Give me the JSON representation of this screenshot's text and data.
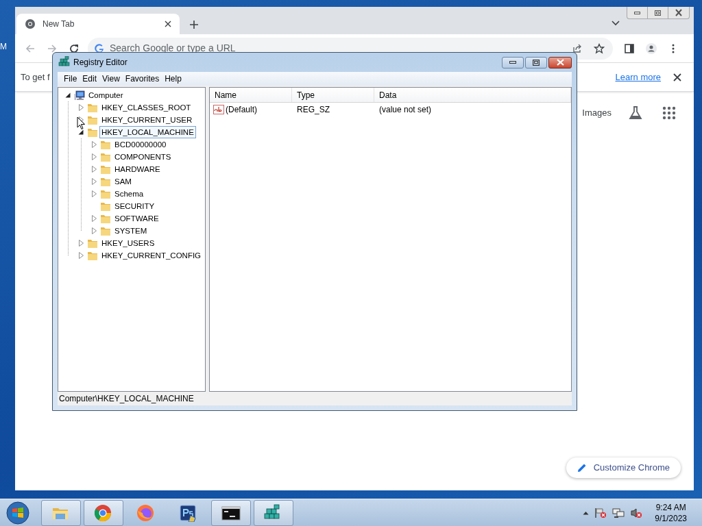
{
  "desktop": {
    "icon_label": "M"
  },
  "browser": {
    "tabs": [
      {
        "label": "New Tab",
        "selected": true
      }
    ],
    "omnibox": {
      "placeholder": "Search Google or type a URL"
    },
    "infobar": {
      "text": "To get f",
      "link": "Learn more"
    },
    "ntp_links": [
      "Images"
    ],
    "customize_button": "Customize Chrome"
  },
  "regedit": {
    "window": {
      "title": "Registry Editor"
    },
    "menu": [
      "File",
      "Edit",
      "View",
      "Favorites",
      "Help"
    ],
    "tree": [
      {
        "kind": "computer",
        "label": "Computer",
        "expandable": true,
        "expanded": true,
        "selected": false,
        "children": [
          {
            "kind": "folder",
            "label": "HKEY_CLASSES_ROOT",
            "expandable": true,
            "expanded": false,
            "selected": false
          },
          {
            "kind": "folder",
            "label": "HKEY_CURRENT_USER",
            "expandable": true,
            "expanded": false,
            "selected": false
          },
          {
            "kind": "folder",
            "label": "HKEY_LOCAL_MACHINE",
            "expandable": true,
            "expanded": true,
            "selected": true,
            "children": [
              {
                "kind": "folder",
                "label": "BCD00000000",
                "expandable": true,
                "expanded": false,
                "selected": false
              },
              {
                "kind": "folder",
                "label": "COMPONENTS",
                "expandable": true,
                "expanded": false,
                "selected": false
              },
              {
                "kind": "folder",
                "label": "HARDWARE",
                "expandable": true,
                "expanded": false,
                "selected": false
              },
              {
                "kind": "folder",
                "label": "SAM",
                "expandable": true,
                "expanded": false,
                "selected": false
              },
              {
                "kind": "folder",
                "label": "Schema",
                "expandable": true,
                "expanded": false,
                "selected": false
              },
              {
                "kind": "folder",
                "label": "SECURITY",
                "expandable": false,
                "expanded": false,
                "selected": false
              },
              {
                "kind": "folder",
                "label": "SOFTWARE",
                "expandable": true,
                "expanded": false,
                "selected": false
              },
              {
                "kind": "folder",
                "label": "SYSTEM",
                "expandable": true,
                "expanded": false,
                "selected": false
              }
            ]
          },
          {
            "kind": "folder",
            "label": "HKEY_USERS",
            "expandable": true,
            "expanded": false,
            "selected": false
          },
          {
            "kind": "folder",
            "label": "HKEY_CURRENT_CONFIG",
            "expandable": true,
            "expanded": false,
            "selected": false
          }
        ]
      }
    ],
    "columns": [
      "Name",
      "Type",
      "Data"
    ],
    "rows": [
      {
        "name": "(Default)",
        "type": "REG_SZ",
        "data": "(value not set)"
      }
    ],
    "status_bar": "Computer\\HKEY_LOCAL_MACHINE"
  },
  "taskbar": {
    "apps": [
      {
        "kind": "explorer",
        "open": true
      },
      {
        "kind": "chrome",
        "open": true
      },
      {
        "kind": "firefox",
        "open": false
      },
      {
        "kind": "photoshop",
        "open": false
      },
      {
        "kind": "cmd",
        "open": true
      },
      {
        "kind": "regedit",
        "open": true
      }
    ],
    "clock": {
      "time": "9:24 AM",
      "date": "9/1/2023"
    }
  }
}
